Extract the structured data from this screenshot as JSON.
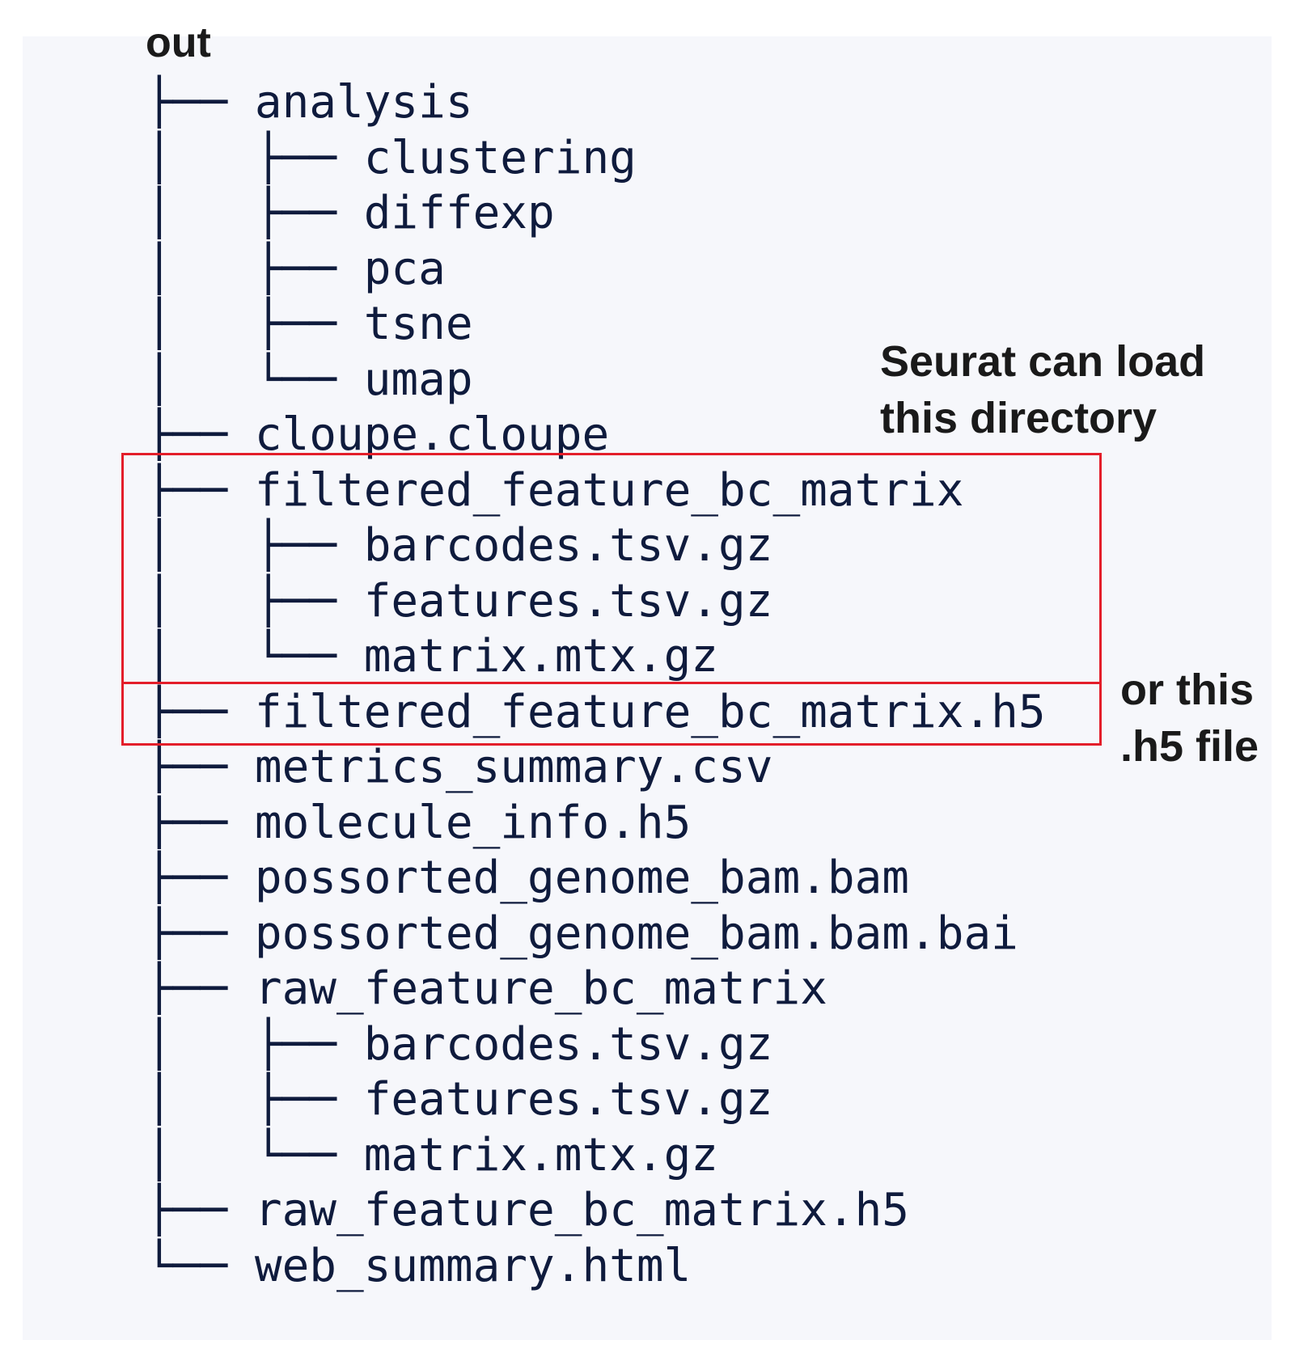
{
  "root_label": "out",
  "rows": [
    {
      "prefix": "├── ",
      "name": "analysis"
    },
    {
      "prefix": "│   ├── ",
      "name": "clustering"
    },
    {
      "prefix": "│   ├── ",
      "name": "diffexp"
    },
    {
      "prefix": "│   ├── ",
      "name": "pca"
    },
    {
      "prefix": "│   ├── ",
      "name": "tsne"
    },
    {
      "prefix": "│   └── ",
      "name": "umap"
    },
    {
      "prefix": "├── ",
      "name": "cloupe.cloupe"
    },
    {
      "prefix": "├── ",
      "name": "filtered_feature_bc_matrix"
    },
    {
      "prefix": "│   ├── ",
      "name": "barcodes.tsv.gz"
    },
    {
      "prefix": "│   ├── ",
      "name": "features.tsv.gz"
    },
    {
      "prefix": "│   └── ",
      "name": "matrix.mtx.gz"
    },
    {
      "prefix": "├── ",
      "name": "filtered_feature_bc_matrix.h5"
    },
    {
      "prefix": "├── ",
      "name": "metrics_summary.csv"
    },
    {
      "prefix": "├── ",
      "name": "molecule_info.h5"
    },
    {
      "prefix": "├── ",
      "name": "possorted_genome_bam.bam"
    },
    {
      "prefix": "├── ",
      "name": "possorted_genome_bam.bam.bai"
    },
    {
      "prefix": "├── ",
      "name": "raw_feature_bc_matrix"
    },
    {
      "prefix": "│   ├── ",
      "name": "barcodes.tsv.gz"
    },
    {
      "prefix": "│   ├── ",
      "name": "features.tsv.gz"
    },
    {
      "prefix": "│   └── ",
      "name": "matrix.mtx.gz"
    },
    {
      "prefix": "├── ",
      "name": "raw_feature_bc_matrix.h5"
    },
    {
      "prefix": "└── ",
      "name": "web_summary.html"
    }
  ],
  "annotations": {
    "directory_note": [
      "Seurat can load",
      "this directory"
    ],
    "h5_note": [
      "or this",
      ".h5 file"
    ]
  },
  "colors": {
    "tree_text": "#0f1b3d",
    "highlight_box": "#e31e2a",
    "panel_bg": "#f6f7fb"
  }
}
